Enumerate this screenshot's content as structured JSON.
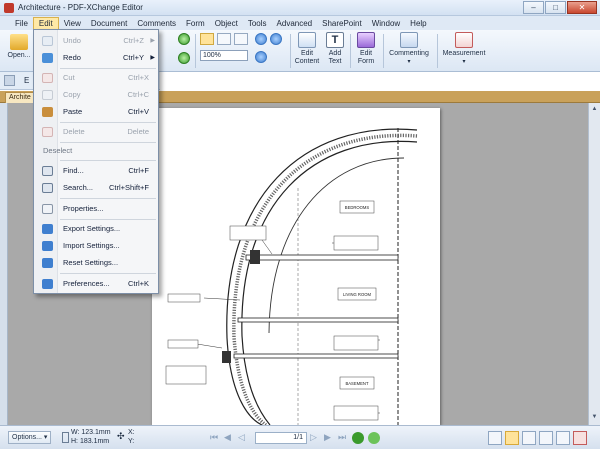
{
  "window": {
    "title": "Architecture - PDF-XChange Editor",
    "minimize_glyph": "–",
    "maximize_glyph": "□",
    "close_glyph": "✕"
  },
  "menubar": {
    "items": [
      "File",
      "Edit",
      "View",
      "Document",
      "Comments",
      "Form",
      "Object",
      "Tools",
      "Advanced",
      "SharePoint",
      "Window",
      "Help"
    ],
    "active": "Edit"
  },
  "ribbon": {
    "open_label": "Open...",
    "zoom_value": "100%",
    "edit_content": [
      "Edit",
      "Content"
    ],
    "add_text": [
      "Add",
      "Text"
    ],
    "edit_form": [
      "Edit",
      "Form"
    ],
    "commenting": "Commenting",
    "measurement": "Measurement"
  },
  "toolbar2": {
    "partial_label": "E"
  },
  "tabs": {
    "document_tab": "Archite"
  },
  "edit_menu": {
    "items": [
      {
        "label": "Undo",
        "shortcut": "Ctrl+Z",
        "submenu": true,
        "disabled": true,
        "icon": "undo-icon"
      },
      {
        "label": "Redo",
        "shortcut": "Ctrl+Y",
        "submenu": true,
        "disabled": false,
        "icon": "redo-icon"
      },
      {
        "label": "Cut",
        "shortcut": "Ctrl+X",
        "disabled": true,
        "icon": "scissors-icon"
      },
      {
        "label": "Copy",
        "shortcut": "Ctrl+C",
        "disabled": true,
        "icon": "copy-icon"
      },
      {
        "label": "Paste",
        "shortcut": "Ctrl+V",
        "disabled": false,
        "icon": "paste-icon"
      },
      {
        "label": "Delete",
        "shortcut": "Delete",
        "disabled": true,
        "icon": "delete-icon"
      },
      {
        "label": "Deselect",
        "section": true
      },
      {
        "label": "Find...",
        "shortcut": "Ctrl+F",
        "disabled": false,
        "icon": "find-icon"
      },
      {
        "label": "Search...",
        "shortcut": "Ctrl+Shift+F",
        "disabled": false,
        "icon": "search-icon"
      },
      {
        "label": "Properties...",
        "shortcut": "",
        "disabled": false,
        "icon": "properties-icon"
      },
      {
        "label": "Export Settings...",
        "shortcut": "",
        "disabled": false,
        "icon": "export-settings-icon"
      },
      {
        "label": "Import Settings...",
        "shortcut": "",
        "disabled": false,
        "icon": "import-settings-icon"
      },
      {
        "label": "Reset Settings...",
        "shortcut": "",
        "disabled": false,
        "icon": "reset-settings-icon"
      },
      {
        "label": "Preferences...",
        "shortcut": "Ctrl+K",
        "disabled": false,
        "icon": "preferences-icon"
      }
    ]
  },
  "statusbar": {
    "options_label": "Options...",
    "width_label": "W: 123.1mm",
    "height_label": "H: 183.1mm",
    "x_label": "X:",
    "y_label": "Y:",
    "page_value": "1/1"
  },
  "drawing": {
    "room_labels": [
      "BEDROOMS",
      "LIVING ROOM",
      "BASEMENT"
    ]
  },
  "colors": {
    "accent": "#ffe9a6",
    "menu_bg": "#f5f6f8",
    "workspace": "#a9a9a9"
  }
}
